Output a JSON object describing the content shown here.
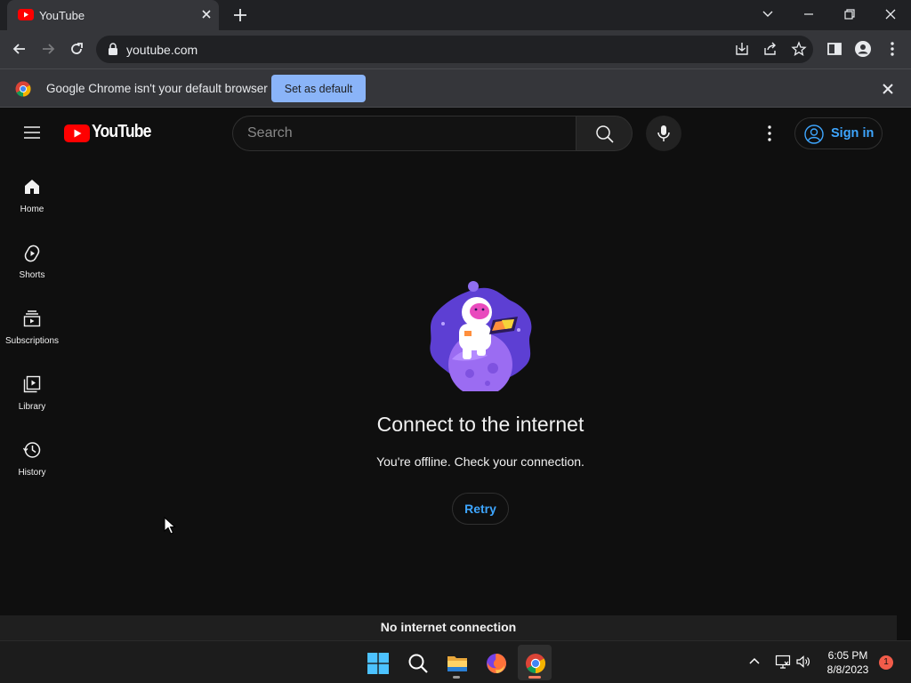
{
  "browser": {
    "tab_title": "YouTube",
    "url": "youtube.com"
  },
  "infobar": {
    "message": "Google Chrome isn't your default browser",
    "button_label": "Set as default"
  },
  "youtube": {
    "logo_text": "YouTube",
    "search_placeholder": "Search",
    "sign_in_label": "Sign in",
    "sidebar": [
      {
        "label": "Home",
        "icon": "home-icon"
      },
      {
        "label": "Shorts",
        "icon": "shorts-icon"
      },
      {
        "label": "Subscriptions",
        "icon": "subscriptions-icon"
      },
      {
        "label": "Library",
        "icon": "library-icon"
      },
      {
        "label": "History",
        "icon": "history-icon"
      }
    ],
    "offline": {
      "title": "Connect to the internet",
      "subtitle": "You're offline. Check your connection.",
      "retry_label": "Retry"
    },
    "toast": "No internet connection"
  },
  "taskbar": {
    "time": "6:05 PM",
    "date": "8/8/2023",
    "notification_count": "1"
  },
  "colors": {
    "accent_blue": "#3ea6ff",
    "youtube_red": "#ff0000",
    "chrome_blue": "#8ab4f8"
  }
}
